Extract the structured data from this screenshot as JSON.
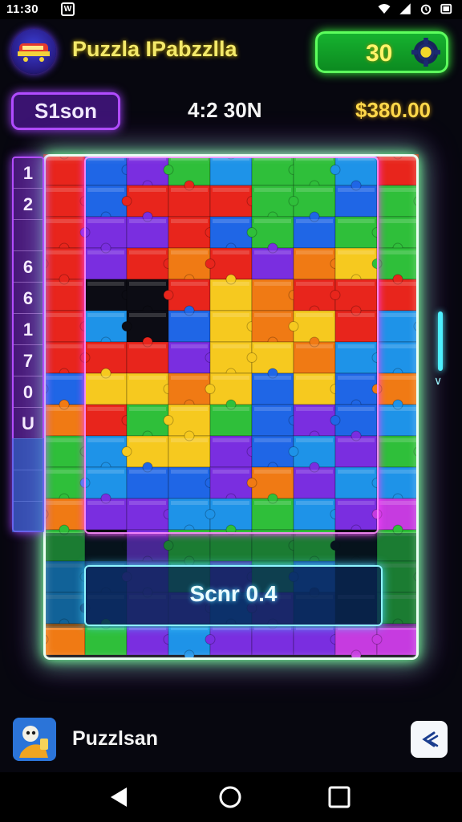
{
  "status_bar": {
    "time": "11:30",
    "app_icon_glyph": "W",
    "icons": [
      "wifi-icon",
      "signal-icon",
      "alarm-icon",
      "battery-icon"
    ]
  },
  "header": {
    "title": "Puzzla IPabzzlla",
    "score": "30",
    "logo_icon": "train-logo-icon",
    "settings_icon": "gear-icon"
  },
  "info": {
    "season_label": "S1son",
    "timer": "4:2 30N",
    "money": "$380.00"
  },
  "row_numbers": [
    "1",
    "2",
    "",
    "6",
    "6",
    "1",
    "7",
    "0",
    "U",
    "",
    "",
    ""
  ],
  "board": {
    "cols": 9,
    "rows": 12,
    "palette": {
      "R": "#e8251c",
      "O": "#f07a14",
      "Y": "#f6c91f",
      "G": "#2fbf3a",
      "B": "#1f66e6",
      "C": "#1e93e8",
      "P": "#7a2ee0",
      "M": "#c63be0",
      "K": "#0c0c14",
      "D": "#1d3fa0"
    },
    "cells": [
      "RBPGCGGCR",
      "RBRRRGGBG",
      "RPPRBGBGG",
      "RPRORPOYG",
      "RKKRYORRR",
      "RCKBYOYRC",
      "RRRPYYOCC",
      "BYYOYBYBO",
      "ORGYGBPBC",
      "GCYYPBCPG",
      "GCBBPOPCC",
      "OPPCCGCPM"
    ],
    "lower_cells": [
      "GKPGGGGKG",
      "CDPGPGBKG",
      "CDPPBPDKG",
      "OGPCPPPMM"
    ],
    "accent_color": "#7dff9e",
    "frame_glow": "#c93cff"
  },
  "score_overlay": {
    "text": "Scnr 0.4"
  },
  "bottom_bar": {
    "title": "Puzzlsan",
    "avatar_icon": "character-avatar-icon",
    "action_icon": "back-swipe-icon"
  },
  "nav": [
    "back-icon",
    "home-icon",
    "recents-icon"
  ]
}
